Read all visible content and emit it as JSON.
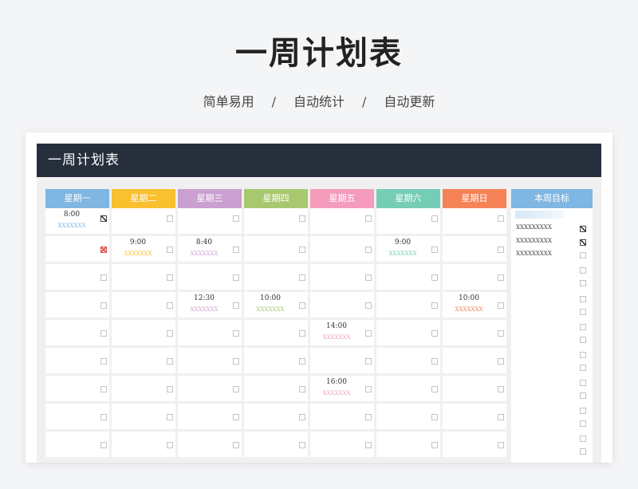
{
  "hero": {
    "title": "一周计划表",
    "subtitle": [
      "简单易用",
      "自动统计",
      "自动更新"
    ],
    "separator": "/"
  },
  "sheet": {
    "title": "一周计划表",
    "columns": [
      {
        "label": "星期一",
        "color": "#7fb6e2"
      },
      {
        "label": "星期二",
        "color": "#f9c02f"
      },
      {
        "label": "星期三",
        "color": "#c9a0cf"
      },
      {
        "label": "星期四",
        "color": "#a8c86f"
      },
      {
        "label": "星期五",
        "color": "#f59cbd"
      },
      {
        "label": "星期六",
        "color": "#76cdb5"
      },
      {
        "label": "星期日",
        "color": "#f58355"
      }
    ],
    "goals_header": {
      "label": "本周目标",
      "color": "#7fb6e2"
    },
    "rows": [
      [
        {
          "time": "8:00",
          "task": "XXXXXXX",
          "status": "checked"
        },
        {},
        {},
        {},
        {},
        {},
        {}
      ],
      [
        {
          "status": "crossed"
        },
        {
          "time": "9:00",
          "task": "XXXXXXX"
        },
        {
          "time": "8:40",
          "task": "XXXXXXX"
        },
        {},
        {},
        {
          "time": "9:00",
          "task": "XXXXXXX"
        },
        {}
      ],
      [
        {},
        {},
        {},
        {},
        {},
        {},
        {}
      ],
      [
        {},
        {},
        {
          "time": "12:30",
          "task": "XXXXXXX"
        },
        {
          "time": "10:00",
          "task": "XXXXXXX"
        },
        {},
        {},
        {
          "time": "10:00",
          "task": "XXXXXXX"
        }
      ],
      [
        {},
        {},
        {},
        {},
        {
          "time": "14:00",
          "task": "XXXXXXX"
        },
        {},
        {}
      ],
      [
        {},
        {},
        {},
        {},
        {},
        {},
        {}
      ],
      [
        {},
        {},
        {},
        {},
        {
          "time": "16:00",
          "task": "XXXXXXX"
        },
        {},
        {}
      ],
      [
        {},
        {},
        {},
        {},
        {},
        {},
        {}
      ],
      [
        {},
        {},
        {},
        {},
        {},
        {},
        {}
      ]
    ],
    "goals": [
      {
        "text": "XXXXXXXXX",
        "status": "checked"
      },
      {
        "text": "XXXXXXXXX",
        "status": "checked"
      },
      {
        "text": "XXXXXXXXX",
        "status": "unchecked"
      },
      {
        "text": "",
        "status": "unchecked"
      },
      {
        "text": "",
        "status": "unchecked"
      },
      {
        "text": "",
        "status": "unchecked"
      },
      {
        "text": "",
        "status": "unchecked"
      },
      {
        "text": "",
        "status": "unchecked"
      },
      {
        "text": "",
        "status": "unchecked"
      },
      {
        "text": "",
        "status": "unchecked"
      },
      {
        "text": "",
        "status": "unchecked"
      },
      {
        "text": "",
        "status": "unchecked"
      },
      {
        "text": "",
        "status": "unchecked"
      },
      {
        "text": "",
        "status": "unchecked"
      },
      {
        "text": "",
        "status": "unchecked"
      },
      {
        "text": "",
        "status": "unchecked"
      },
      {
        "text": "",
        "status": "unchecked"
      }
    ]
  }
}
